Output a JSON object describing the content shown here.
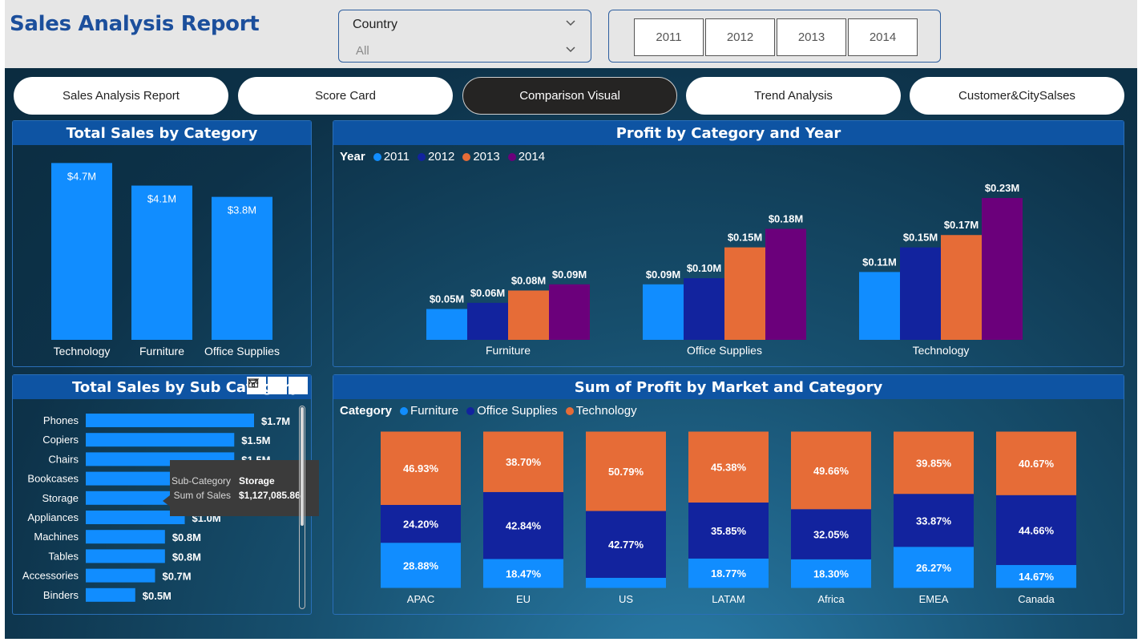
{
  "header": {
    "title": "Sales Analysis Report",
    "country_filter": {
      "label": "Country",
      "value": "All"
    },
    "years": [
      "2011",
      "2012",
      "2013",
      "2014"
    ]
  },
  "nav": {
    "tabs": [
      {
        "label": "Sales Analysis Report",
        "active": false
      },
      {
        "label": "Score Card",
        "active": false
      },
      {
        "label": "Comparison Visual",
        "active": true
      },
      {
        "label": "Trend Analysis",
        "active": false
      },
      {
        "label": "Customer&CitySalses",
        "active": false
      }
    ]
  },
  "colors": {
    "bar_blue": "#118dff",
    "dark_blue": "#12239e",
    "orange": "#e66c37",
    "purple": "#6b007b",
    "panel_header": "#0e54a3"
  },
  "tooltip": {
    "rows": [
      {
        "key": "Sub-Category",
        "value": "Storage"
      },
      {
        "key": "Sum of Sales",
        "value": "$1,127,085.86"
      }
    ]
  },
  "chart_data": [
    {
      "id": "sales_by_category",
      "type": "bar",
      "title": "Total Sales by Category",
      "categories": [
        "Technology",
        "Furniture",
        "Office Supplies"
      ],
      "values": [
        4.7,
        4.1,
        3.8
      ],
      "labels": [
        "$4.7M",
        "$4.1M",
        "$3.8M"
      ],
      "unit": "$M",
      "ylim": [
        0,
        4.9
      ]
    },
    {
      "id": "profit_by_category_year",
      "type": "bar",
      "title": "Profit by Category and Year",
      "legend_title": "Year",
      "categories": [
        "Furniture",
        "Office Supplies",
        "Technology"
      ],
      "series": [
        {
          "name": "2011",
          "values": [
            0.05,
            0.09,
            0.11
          ],
          "labels": [
            "$0.05M",
            "$0.09M",
            "$0.11M"
          ]
        },
        {
          "name": "2012",
          "values": [
            0.06,
            0.1,
            0.15
          ],
          "labels": [
            "$0.06M",
            "$0.10M",
            "$0.15M"
          ]
        },
        {
          "name": "2013",
          "values": [
            0.08,
            0.15,
            0.17
          ],
          "labels": [
            "$0.08M",
            "$0.15M",
            "$0.17M"
          ]
        },
        {
          "name": "2014",
          "values": [
            0.09,
            0.18,
            0.23
          ],
          "labels": [
            "$0.09M",
            "$0.18M",
            "$0.23M"
          ]
        }
      ],
      "unit": "$M",
      "ylim": [
        0,
        0.26
      ],
      "legend_position": "top-left"
    },
    {
      "id": "sales_by_subcategory",
      "type": "bar",
      "orientation": "horizontal",
      "title": "Total Sales by Sub Category",
      "categories": [
        "Phones",
        "Copiers",
        "Chairs",
        "Bookcases",
        "Storage",
        "Appliances",
        "Machines",
        "Tables",
        "Accessories",
        "Binders"
      ],
      "values": [
        1.7,
        1.5,
        1.5,
        1.5,
        1.1,
        1.0,
        0.8,
        0.8,
        0.7,
        0.5
      ],
      "labels": [
        "$1.7M",
        "$1.5M",
        "$1.5M",
        "$1.5M",
        "$1.1M",
        "$1.0M",
        "$0.8M",
        "$0.8M",
        "$0.7M",
        "$0.5M"
      ],
      "unit": "$M",
      "xlim": [
        0,
        1.7
      ]
    },
    {
      "id": "profit_by_market_category",
      "type": "bar",
      "stacked": "100%",
      "title": "Sum of Profit by Market and Category",
      "legend_title": "Category",
      "categories": [
        "APAC",
        "EU",
        "US",
        "LATAM",
        "Africa",
        "EMEA",
        "Canada"
      ],
      "series": [
        {
          "name": "Furniture",
          "values": [
            28.88,
            18.47,
            6.44,
            18.77,
            18.3,
            26.27,
            14.67
          ],
          "labels": [
            "28.88%",
            "18.47%",
            "",
            "18.77%",
            "18.30%",
            "26.27%",
            "14.67%"
          ]
        },
        {
          "name": "Office Supplies",
          "values": [
            24.2,
            42.84,
            42.77,
            35.85,
            32.05,
            33.87,
            44.66
          ],
          "labels": [
            "24.20%",
            "42.84%",
            "42.77%",
            "35.85%",
            "32.05%",
            "33.87%",
            "44.66%"
          ]
        },
        {
          "name": "Technology",
          "values": [
            46.93,
            38.7,
            50.79,
            45.38,
            49.66,
            39.85,
            40.67
          ],
          "labels": [
            "46.93%",
            "38.70%",
            "50.79%",
            "45.38%",
            "49.66%",
            "39.85%",
            "40.67%"
          ]
        }
      ],
      "unit": "%",
      "legend_position": "top-left"
    }
  ]
}
